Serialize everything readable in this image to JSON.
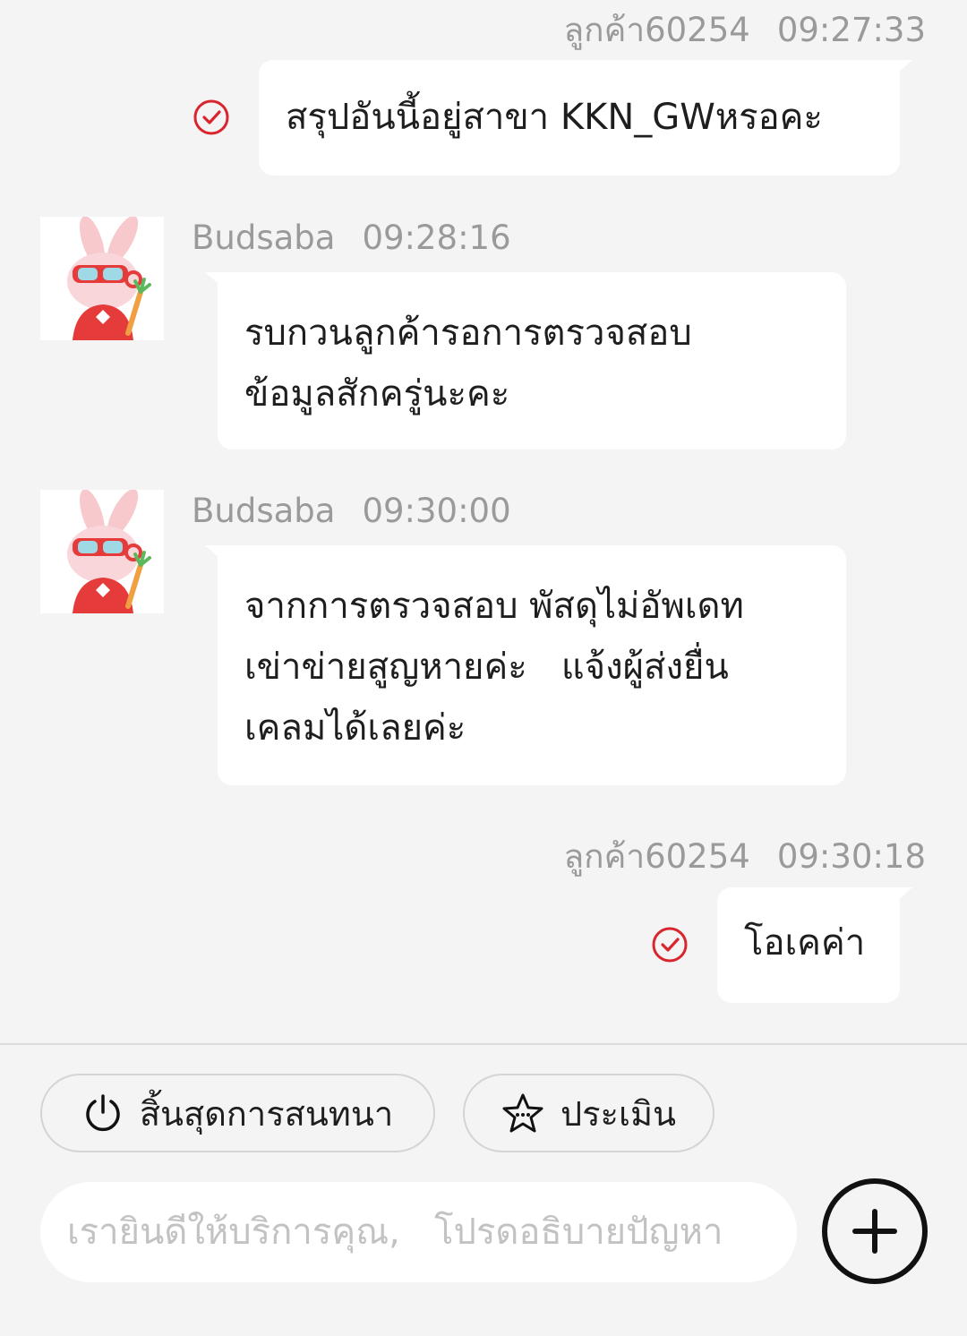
{
  "messages": [
    {
      "side": "right",
      "sender": "ลูกค้า60254",
      "time": "09:27:33",
      "text": "สรุปอันนี้อยู่สาขา KKN_GWหรอคะ"
    },
    {
      "side": "left",
      "sender": "Budsaba",
      "time": "09:28:16",
      "line1": "รบกวนลูกค้ารอการตรวจสอบ",
      "line2": "ข้อมูลสักครู่นะคะ"
    },
    {
      "side": "left",
      "sender": "Budsaba",
      "time": "09:30:00",
      "line1": "จากการตรวจสอบ พัสดุไม่อัพเดท",
      "line2": "เข่าข่ายสูญหายค่ะ   แจ้งผู้ส่งยื่น",
      "line3": "เคลมได้เลยค่ะ"
    },
    {
      "side": "right",
      "sender": "ลูกค้า60254",
      "time": "09:30:18",
      "text": "โอเคค่า"
    }
  ],
  "actions": {
    "end_chat": "สิ้นสุดการสนทนา",
    "rate": "ประเมิน"
  },
  "composer": {
    "placeholder": "เรายินดีให้บริการคุณ,   โปรดอธิบายปัญหา"
  },
  "icons": {
    "read": "check-circle-icon",
    "end": "power-icon",
    "rate": "star-icon",
    "add": "plus-icon"
  },
  "colors": {
    "accent": "#d9262e",
    "background": "#f4f4f4",
    "bubble": "#ffffff",
    "meta": "#9a9a9a"
  }
}
